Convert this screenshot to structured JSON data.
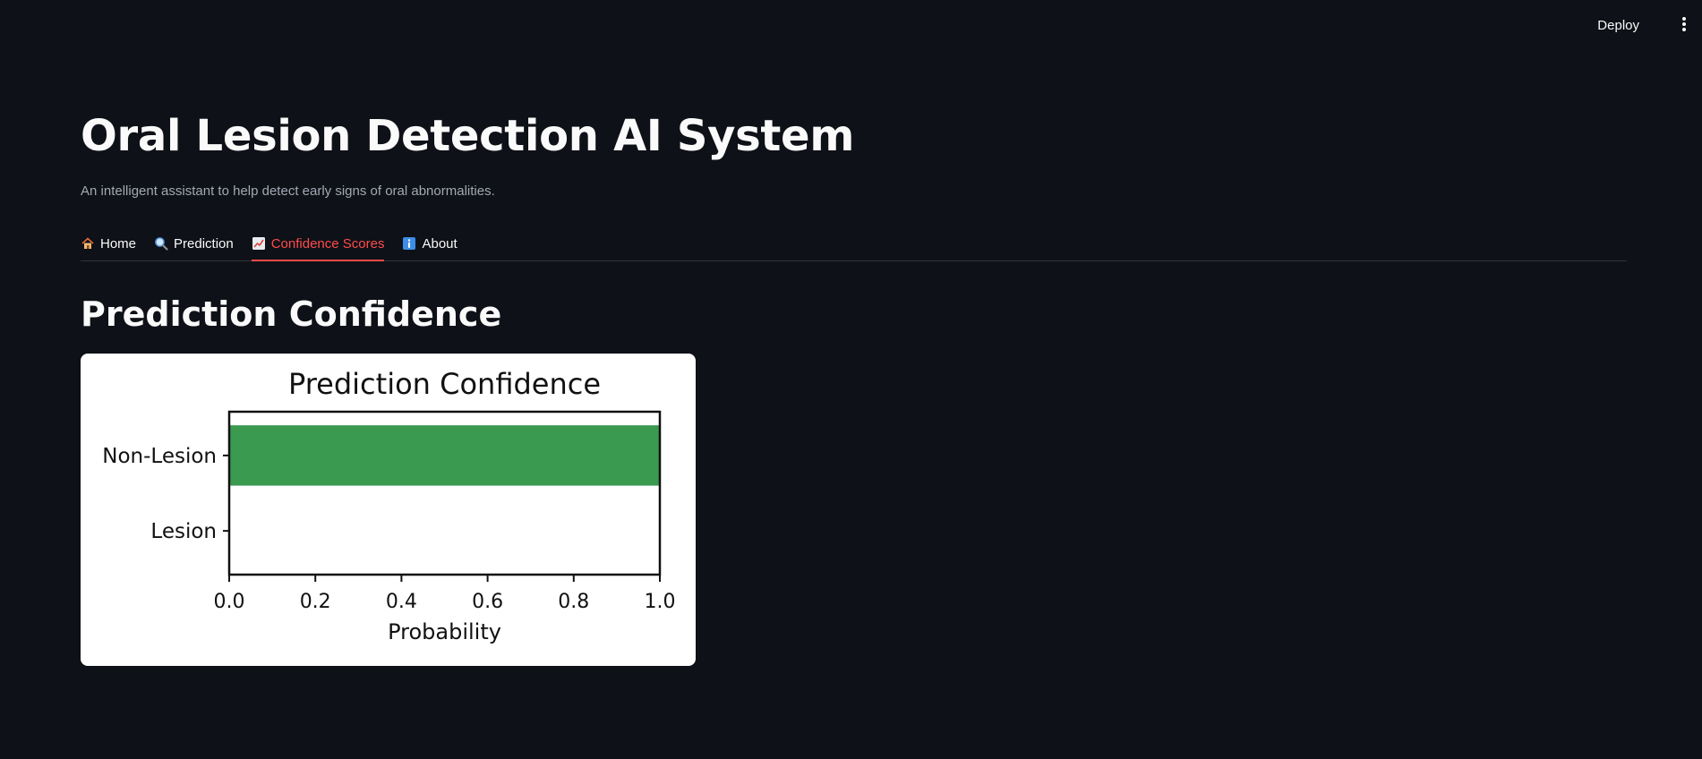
{
  "header": {
    "deploy_label": "Deploy",
    "menu_icon": "vertical-ellipsis-icon"
  },
  "page": {
    "title": "Oral Lesion Detection AI System",
    "subtitle": "An intelligent assistant to help detect early signs of oral abnormalities."
  },
  "tabs": [
    {
      "label": "Home",
      "icon": "house-icon",
      "active": false
    },
    {
      "label": "Prediction",
      "icon": "magnifier-icon",
      "active": false
    },
    {
      "label": "Confidence Scores",
      "icon": "chart-increasing-icon",
      "active": true
    },
    {
      "label": "About",
      "icon": "info-icon",
      "active": false
    }
  ],
  "section": {
    "title": "Prediction Confidence"
  },
  "colors": {
    "background": "#0e1117",
    "accent": "#ff4b4b",
    "bar": "#3a9a50"
  },
  "chart_data": {
    "type": "bar",
    "orientation": "horizontal",
    "title": "Prediction Confidence",
    "xlabel": "Probability",
    "ylabel": "",
    "categories": [
      "Non-Lesion",
      "Lesion"
    ],
    "values": [
      1.0,
      0.0
    ],
    "xlim": [
      0,
      1
    ],
    "xticks": [
      "0.0",
      "0.2",
      "0.4",
      "0.6",
      "0.8",
      "1.0"
    ],
    "grid": false,
    "legend": "none"
  }
}
